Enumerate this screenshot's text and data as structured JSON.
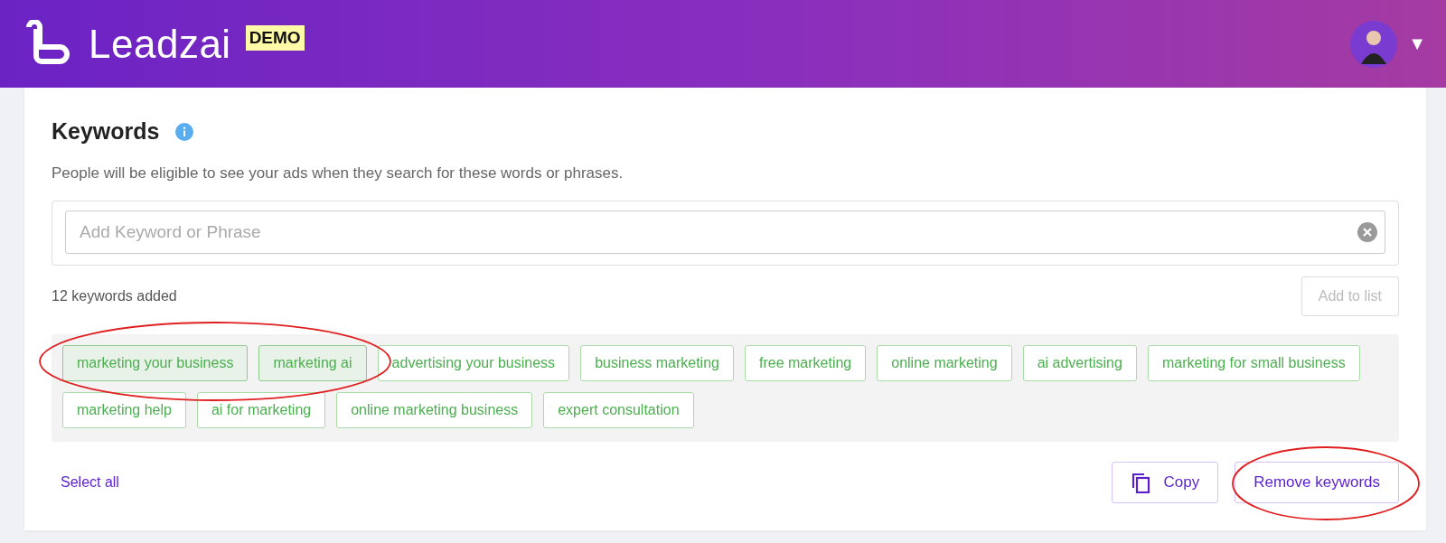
{
  "header": {
    "brand": "Leadzai",
    "badge": "DEMO",
    "menu_caret": "▼"
  },
  "keywords": {
    "title": "Keywords",
    "description": "People will be eligible to see your ads when they search for these words or phrases.",
    "input": {
      "placeholder": "Add Keyword or Phrase"
    },
    "count": "12 keywords added",
    "add_button": {
      "label": "Add to list",
      "disabled": true
    },
    "items": [
      {
        "label": "marketing your business",
        "selected": true
      },
      {
        "label": "marketing ai",
        "selected": true
      },
      {
        "label": "advertising your business",
        "selected": false
      },
      {
        "label": "business marketing",
        "selected": false
      },
      {
        "label": "free marketing",
        "selected": false
      },
      {
        "label": "online marketing",
        "selected": false
      },
      {
        "label": "ai advertising",
        "selected": false
      },
      {
        "label": "marketing for small business",
        "selected": false
      },
      {
        "label": "marketing help",
        "selected": false
      },
      {
        "label": "ai for marketing",
        "selected": false
      },
      {
        "label": "online marketing business",
        "selected": false
      },
      {
        "label": "expert consultation",
        "selected": false
      }
    ],
    "select_all": "Select all",
    "copy_button": "Copy",
    "remove_button": "Remove keywords"
  },
  "annotations": [
    {
      "kind": "ellipse"
    },
    {
      "kind": "ellipse"
    }
  ]
}
